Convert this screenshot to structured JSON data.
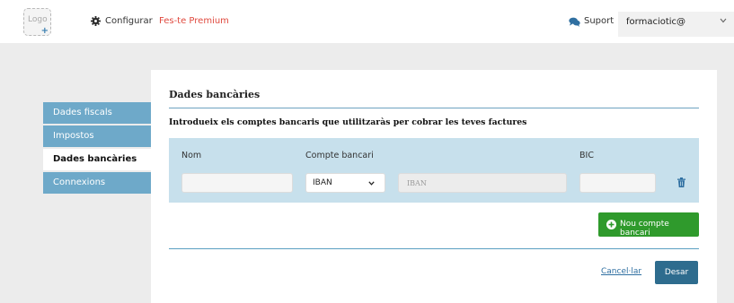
{
  "header": {
    "logo_label": "Logo",
    "logo_add": "+",
    "config_label": "Configurar",
    "premium_label": "Fes-te Premium",
    "support_label": "Suport",
    "user_selected": "formaciotic@"
  },
  "sidebar": {
    "items": [
      {
        "label": "Dades fiscals"
      },
      {
        "label": "Impostos"
      },
      {
        "label": "Dades bancàries"
      },
      {
        "label": "Connexions"
      }
    ],
    "active_index": 2
  },
  "main": {
    "section_title": "Dades bancàries",
    "intro": "Introdueix els comptes bancaris que utilitzaràs per cobrar les teves factures",
    "columns": {
      "name": "Nom",
      "account": "Compte bancari",
      "bic": "BIC"
    },
    "account_row": {
      "name_value": "",
      "type_selected": "IBAN",
      "iban_placeholder": "IBAN",
      "bic_value": ""
    },
    "add_button": "Nou compte bancari",
    "cancel_link": "Cancel·lar",
    "save_button": "Desar"
  },
  "colors": {
    "accent_blue": "#6ea9c9",
    "panel_blue": "#c7e0ec",
    "premium_red": "#e04a3f",
    "add_green": "#2f9a2c",
    "save_blue": "#2e6c8e"
  },
  "icons": [
    "plus-icon",
    "gear-icon",
    "chat-icon",
    "chevron-down-icon",
    "trash-icon",
    "plus-circle-icon"
  ]
}
